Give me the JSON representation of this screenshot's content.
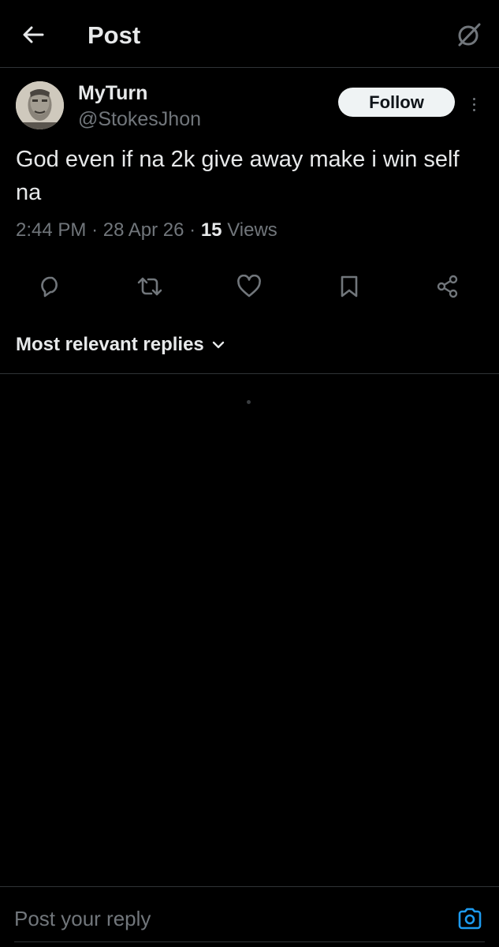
{
  "header": {
    "title": "Post",
    "back_icon": "arrow-left-icon",
    "grok_icon": "grok-icon"
  },
  "author": {
    "display_name": "MyTurn",
    "handle": "@StokesJhon",
    "follow_label": "Follow",
    "more_icon": "more-vertical-icon"
  },
  "post": {
    "text": "God even if na 2k give away make i win self na",
    "time": "2:44 PM",
    "date": "28 Apr 26",
    "views_count": "15",
    "views_label": "Views",
    "separator": "·"
  },
  "actions": [
    {
      "name": "reply",
      "icon": "reply-icon"
    },
    {
      "name": "repost",
      "icon": "repost-icon"
    },
    {
      "name": "like",
      "icon": "heart-icon"
    },
    {
      "name": "bookmark",
      "icon": "bookmark-icon"
    },
    {
      "name": "share",
      "icon": "share-icon"
    }
  ],
  "replies": {
    "sort_label": "Most relevant replies",
    "sort_icon": "chevron-down-icon"
  },
  "composer": {
    "placeholder": "Post your reply",
    "camera_icon": "camera-icon"
  },
  "colors": {
    "background": "#000000",
    "text_primary": "#e7e9ea",
    "text_secondary": "#71767b",
    "divider": "#2f3336",
    "follow_bg": "#eff3f4",
    "accent": "#1d9bf0"
  }
}
